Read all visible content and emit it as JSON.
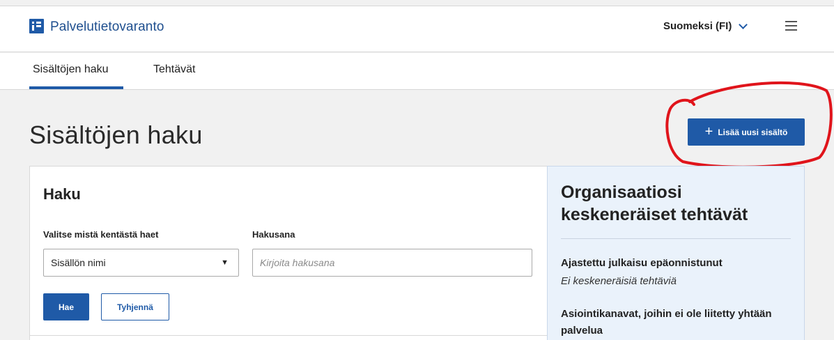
{
  "header": {
    "brand": "Palvelutietovaranto",
    "language": "Suomeksi (FI)"
  },
  "tabs": [
    {
      "label": "Sisältöjen haku",
      "active": true
    },
    {
      "label": "Tehtävät",
      "active": false
    }
  ],
  "page": {
    "title": "Sisältöjen haku",
    "add_button_label": "Lisää uusi sisältö"
  },
  "search": {
    "title": "Haku",
    "field_label": "Valitse mistä kentästä haet",
    "field_value": "Sisällön nimi",
    "keyword_label": "Hakusana",
    "keyword_placeholder": "Kirjoita hakusana",
    "keyword_value": "",
    "search_button": "Hae",
    "clear_button": "Tyhjennä"
  },
  "tasks": {
    "title": "Organisaatiosi keskeneräiset tehtävät",
    "items": [
      {
        "title": "Ajastettu julkaisu epäonnistunut",
        "status": "Ei keskeneräisiä tehtäviä"
      },
      {
        "title": "Asiointikanavat, joihin ei ole liitetty yhtään palvelua"
      }
    ]
  },
  "colors": {
    "primary": "#1f5aa7",
    "brand_text": "#1f4f8f",
    "page_background": "#f1f1f1",
    "panel_background": "#eaf2fb",
    "annotation": "#e0141b"
  },
  "icons": [
    "logo-icon",
    "chevron-down-icon",
    "hamburger-menu-icon",
    "plus-icon",
    "caret-down-icon"
  ]
}
